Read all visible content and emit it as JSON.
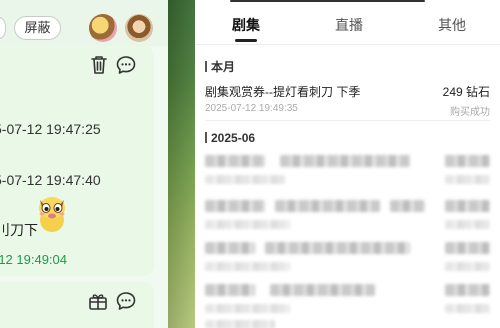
{
  "left_panel": {
    "block_button": "屏蔽",
    "messages": {
      "time_1": "5-07-12 19:47:25",
      "time_2": "5-07-12 19:47:40",
      "text": "刂刀下",
      "time_3": "-12 19:49:04"
    }
  },
  "right_panel": {
    "tabs": [
      "剧集",
      "直播",
      "其他"
    ],
    "active_tab": 0,
    "sections": [
      {
        "header": "本月",
        "items": [
          {
            "title": "剧集观赏券--提灯看刺刀 下季",
            "amount": "249 钻石",
            "date": "2025-07-12 19:49:35",
            "status": "购买成功"
          }
        ]
      },
      {
        "header": "2025-06"
      }
    ]
  },
  "colors": {
    "left_bg": "#f1faf0",
    "card_bg": "#e9f8e7",
    "green_time": "#1f9a4a",
    "right_bg": "#ffffff"
  }
}
